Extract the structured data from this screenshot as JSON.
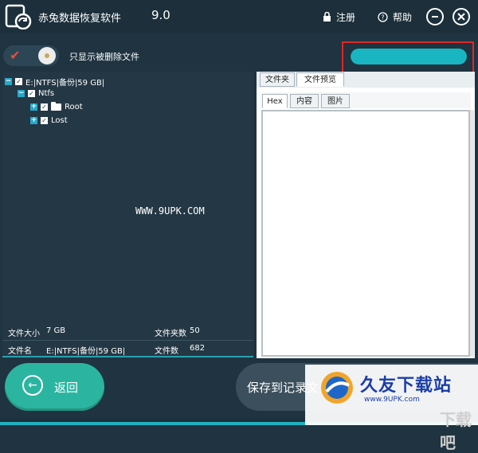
{
  "window": {
    "title": "赤兔数据恢复软件",
    "version": "9.0",
    "register_label": "注册",
    "help_label": "帮助",
    "accent_color": "#1fb2bc"
  },
  "toolbar": {
    "show_deleted_label": "只显示被删除文件",
    "progress_fraction": 0.99
  },
  "tree": {
    "drive_label": "E:|NTFS|备份|59 GB|",
    "fs_label": "Ntfs",
    "root_label": "Root",
    "lost_label": "Lost"
  },
  "info": {
    "file_size_key": "文件大小",
    "file_size_value": "7 GB",
    "folder_count_key": "文件夹数",
    "folder_count_value": "50",
    "file_name_key": "文件名",
    "file_name_value": "E:|NTFS|备份|59 GB|",
    "file_count_key": "文件数",
    "file_count_value": "682"
  },
  "preview": {
    "tab_folder": "文件夹",
    "tab_preview": "文件预览",
    "subtab_hex": "Hex",
    "subtab_content": "内容",
    "subtab_image": "图片"
  },
  "bottom": {
    "back_label": "返回",
    "save_label": "保存到记录文"
  },
  "watermarks": {
    "center": "WWW.9UPK.COM",
    "brand_name": "久友下载站",
    "brand_url": "www.9UPK.com",
    "brand_gray": "下载吧"
  }
}
